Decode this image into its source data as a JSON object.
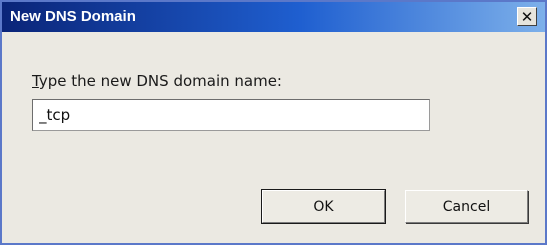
{
  "window": {
    "title": "New DNS Domain",
    "close_glyph": "✕"
  },
  "prompt": {
    "accelerator": "T",
    "rest": "ype the new DNS domain name:"
  },
  "domain_field": {
    "value": "_tcp"
  },
  "buttons": {
    "ok": "OK",
    "cancel": "Cancel"
  },
  "colors": {
    "titlebar_start": "#0a2478",
    "titlebar_end": "#7db0ea",
    "dialog_bg": "#ebe9e2"
  },
  "icons": {
    "close": "close-icon"
  }
}
